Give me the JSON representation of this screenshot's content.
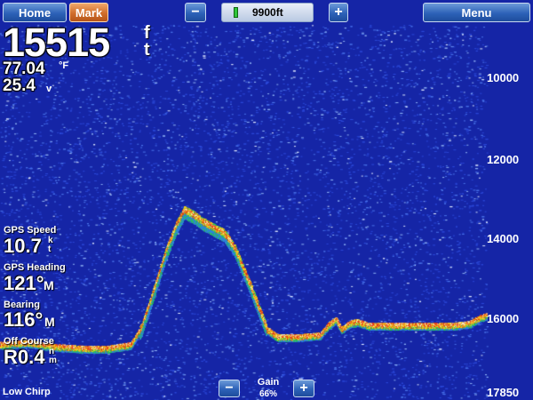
{
  "topbar": {
    "home_label": "Home",
    "mark_label": "Mark",
    "range_minus": "−",
    "range_plus": "+",
    "range_value": "9900ft",
    "menu_label": "Menu"
  },
  "readouts": {
    "depth": {
      "value": "15515",
      "unit_line1": "f",
      "unit_line2": "t"
    },
    "water_temp": {
      "value": "77.04",
      "unit": "°F"
    },
    "voltage": {
      "value": "25.4",
      "unit": "v"
    },
    "gps_speed": {
      "label": "GPS Speed",
      "value": "10.7",
      "unit_line1": "k",
      "unit_line2": "t"
    },
    "gps_heading": {
      "label": "GPS Heading",
      "value": "121°",
      "unit": "M"
    },
    "bearing": {
      "label": "Bearing",
      "value": "116°",
      "unit": "M"
    },
    "off_course": {
      "label": "Off Course",
      "value": "R0.4",
      "unit_line1": "n",
      "unit_line2": "m"
    }
  },
  "depth_scale": [
    "10000",
    "12000",
    "14000",
    "16000",
    "17850"
  ],
  "bottom": {
    "frequency": "Low Chirp",
    "gain_title": "Gain",
    "gain_value": "66%",
    "gain_minus": "−",
    "gain_plus": "+"
  },
  "sonar": {
    "depth_top_ft": 8200,
    "depth_bottom_ft": 17850,
    "background_color": "#1525a6",
    "return_colors": [
      "#f5f5c8",
      "#f0d21e",
      "#e63a14",
      "#26c25a",
      "#2f7ee6"
    ],
    "bottom_profile": [
      {
        "x": 0,
        "depth": 16500
      },
      {
        "x": 0.05,
        "depth": 16450
      },
      {
        "x": 0.1,
        "depth": 16550
      },
      {
        "x": 0.16,
        "depth": 16600
      },
      {
        "x": 0.2,
        "depth": 16600
      },
      {
        "x": 0.245,
        "depth": 16500
      },
      {
        "x": 0.265,
        "depth": 16050
      },
      {
        "x": 0.29,
        "depth": 15000
      },
      {
        "x": 0.31,
        "depth": 14100
      },
      {
        "x": 0.33,
        "depth": 13400
      },
      {
        "x": 0.345,
        "depth": 13000
      },
      {
        "x": 0.36,
        "depth": 13100
      },
      {
        "x": 0.38,
        "depth": 13300
      },
      {
        "x": 0.42,
        "depth": 13600
      },
      {
        "x": 0.44,
        "depth": 14000
      },
      {
        "x": 0.47,
        "depth": 15000
      },
      {
        "x": 0.5,
        "depth": 16100
      },
      {
        "x": 0.52,
        "depth": 16300
      },
      {
        "x": 0.56,
        "depth": 16300
      },
      {
        "x": 0.6,
        "depth": 16250
      },
      {
        "x": 0.615,
        "depth": 16000
      },
      {
        "x": 0.63,
        "depth": 15850
      },
      {
        "x": 0.64,
        "depth": 16100
      },
      {
        "x": 0.655,
        "depth": 15950
      },
      {
        "x": 0.67,
        "depth": 15900
      },
      {
        "x": 0.69,
        "depth": 16000
      },
      {
        "x": 0.75,
        "depth": 16000
      },
      {
        "x": 0.8,
        "depth": 16000
      },
      {
        "x": 0.85,
        "depth": 16000
      },
      {
        "x": 0.88,
        "depth": 15950
      },
      {
        "x": 0.9,
        "depth": 15800
      },
      {
        "x": 0.92,
        "depth": 15700
      }
    ]
  }
}
